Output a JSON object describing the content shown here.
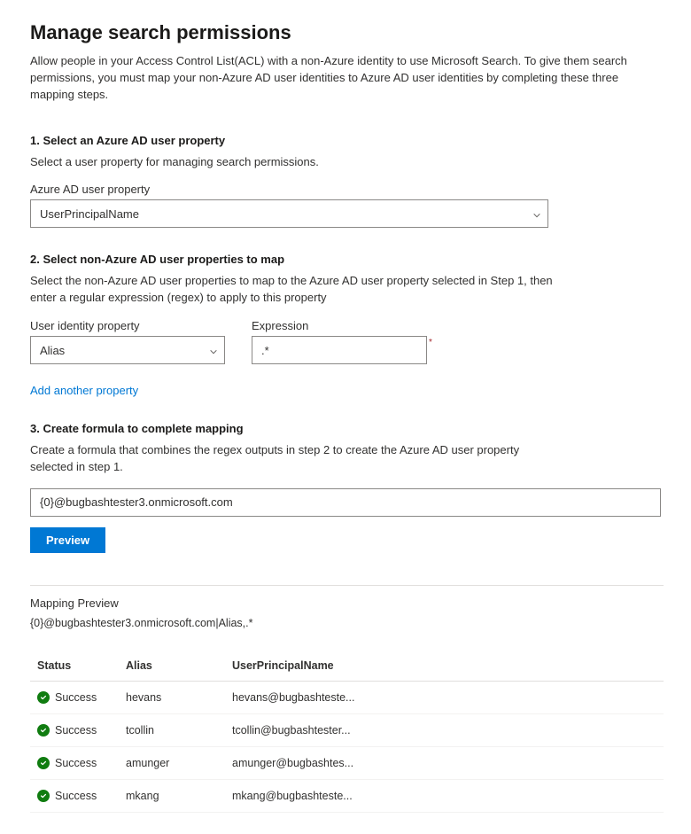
{
  "page": {
    "title": "Manage search permissions",
    "description": "Allow people in your Access Control List(ACL) with a non-Azure identity to use Microsoft Search. To give them search permissions, you must map your non-Azure AD user identities to Azure AD user identities by completing these three mapping steps."
  },
  "step1": {
    "title": "1. Select an Azure AD user property",
    "description": "Select a user property for managing search permissions.",
    "field_label": "Azure AD user property",
    "select_value": "UserPrincipalName"
  },
  "step2": {
    "title": "2. Select non-Azure AD user properties to map",
    "description": "Select the non-Azure AD user properties to map to the Azure AD user property selected in Step 1, then enter a regular expression (regex) to apply to this property",
    "identity_label": "User identity property",
    "identity_value": "Alias",
    "expression_label": "Expression",
    "expression_value": ".*",
    "add_link": "Add another property"
  },
  "step3": {
    "title": "3. Create formula to complete mapping",
    "description": "Create a formula that combines the regex outputs in step 2 to create the Azure AD user property selected in step 1.",
    "formula_value": "{0}@bugbashtester3.onmicrosoft.com",
    "preview_button": "Preview"
  },
  "preview": {
    "title": "Mapping Preview",
    "formula_display": "{0}@bugbashtester3.onmicrosoft.com|Alias,.*",
    "columns": {
      "status": "Status",
      "alias": "Alias",
      "upn": "UserPrincipalName"
    },
    "rows": [
      {
        "status": "Success",
        "alias": "hevans",
        "upn": "hevans@bugbashteste..."
      },
      {
        "status": "Success",
        "alias": "tcollin",
        "upn": "tcollin@bugbashtester..."
      },
      {
        "status": "Success",
        "alias": "amunger",
        "upn": "amunger@bugbashtes..."
      },
      {
        "status": "Success",
        "alias": "mkang",
        "upn": "mkang@bugbashteste..."
      }
    ]
  }
}
